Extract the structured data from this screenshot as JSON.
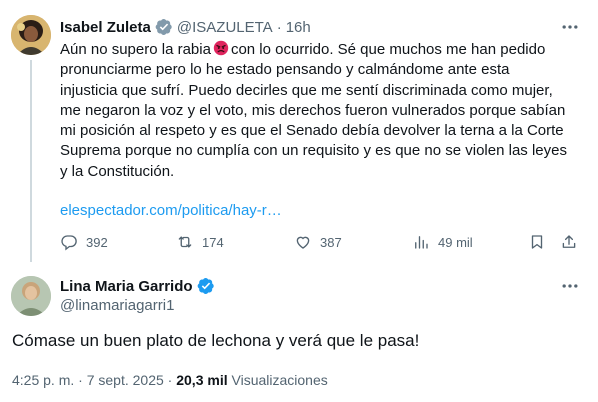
{
  "parent_tweet": {
    "author_name": "Isabel Zuleta",
    "handle": "@ISAZULETA",
    "separator": "·",
    "time": "16h",
    "text_lines": [
      [
        "Aún no supero la rabia",
        "con lo ocurrido. Sé que muchos me han pedido"
      ],
      "pronunciarme pero lo he estado pensando y calmándome ante esta",
      "injusticia que sufrí. Puedo decirles que me sentí discriminada como mujer,",
      "me negaron la voz y el voto, mis derechos fueron vulnerados porque sabían",
      "mi posición al respeto y es que el Senado debía devolver la terna a la Corte",
      "Suprema porque no cumplía con un requisito y es que no se violen las leyes",
      "y la Constitución."
    ],
    "emoji": "angry-face-emoji",
    "link": "elespectador.com/politica/hay-r…",
    "stats": {
      "replies": "392",
      "retweets": "174",
      "likes": "387",
      "views": "49 mil"
    },
    "badge_color": "#829aab"
  },
  "reply": {
    "author_name": "Lina Maria Garrido",
    "handle": "@linamariagarri1",
    "text": "Cómase un buen plato de lechona y verá que le pasa!",
    "meta": {
      "time": "4:25 p. m.",
      "separator": "·",
      "date": "7 sept. 2025",
      "views_count": "20,3 mil",
      "views_label": "Visualizaciones"
    },
    "badge_color": "#1d9bf0"
  },
  "colors": {
    "text": "#0f1419",
    "secondary": "#536471",
    "link": "#1d9bf0",
    "divider": "#cfd9de"
  }
}
